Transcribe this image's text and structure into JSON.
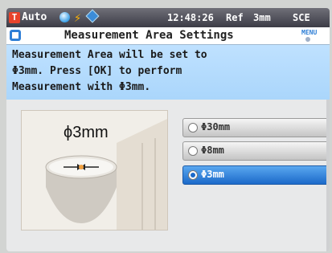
{
  "status": {
    "mode": "Auto",
    "time": "12:48:26",
    "reference": "Ref",
    "area": "3mm",
    "sce": "SCE",
    "mode_badge": "T"
  },
  "title": {
    "text": "Measurement Area Settings",
    "menu": "MENU"
  },
  "message": {
    "line1": "Measurement Area will be set to",
    "line2": "Φ3mm. Press [OK] to perform",
    "line3": "Measurement with Φ3mm."
  },
  "illustration": {
    "label": "ϕ3mm"
  },
  "options": [
    {
      "label": "Φ30mm",
      "selected": false
    },
    {
      "label": "Φ8mm",
      "selected": false
    },
    {
      "label": "Φ3mm",
      "selected": true
    }
  ]
}
